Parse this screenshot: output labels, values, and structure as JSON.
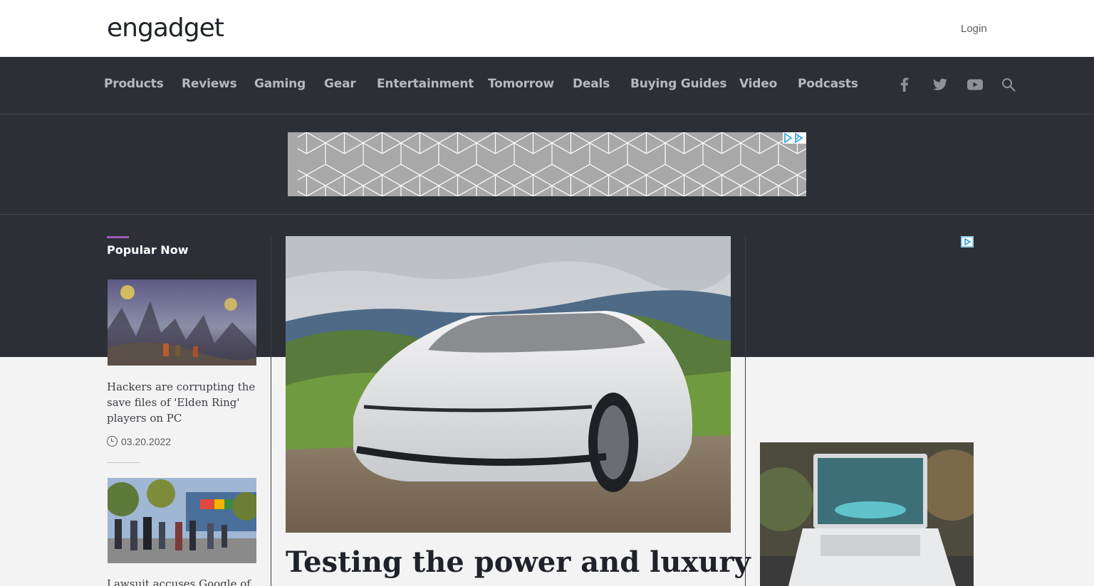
{
  "header": {
    "logo": "engadget",
    "login": "Login"
  },
  "nav": {
    "items": [
      "Products",
      "Reviews",
      "Gaming",
      "Gear",
      "Entertainment",
      "Tomorrow",
      "Deals",
      "Buying Guides",
      "Video",
      "Podcasts"
    ],
    "social": [
      "facebook-icon",
      "twitter-icon",
      "youtube-icon",
      "search-icon"
    ]
  },
  "popular": {
    "title": "Popular Now",
    "stories": [
      {
        "title": "Hackers are corrupting the save files of 'Elden Ring' players on PC",
        "date": "03.20.2022"
      },
      {
        "title": "Lawsuit accuses Google of"
      }
    ]
  },
  "hero": {
    "title": "Testing the power and luxury of"
  },
  "colors": {
    "accent": "#9b59b6",
    "nav_bg": "#2c2f35",
    "nav_text": "#b7b9bd"
  }
}
